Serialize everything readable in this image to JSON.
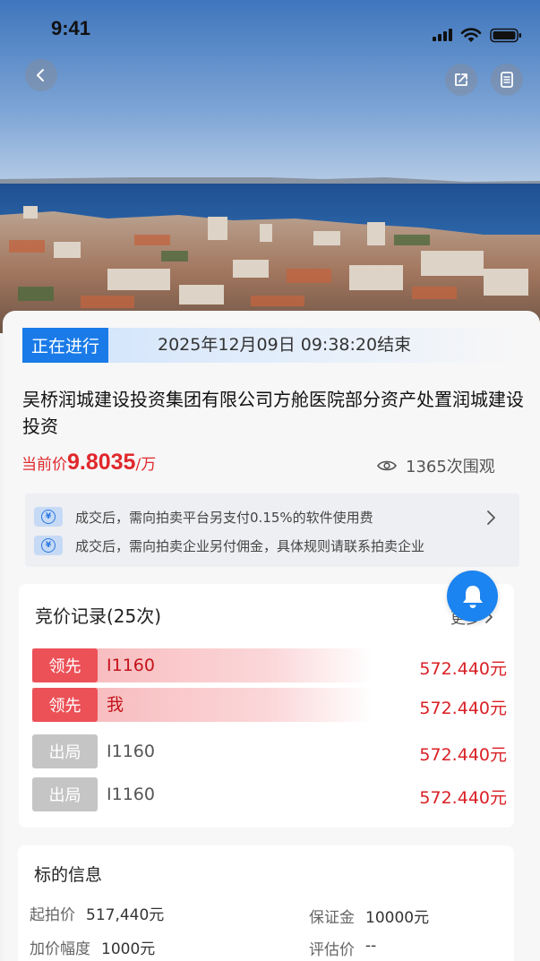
{
  "status_bar": {
    "time": "9:41"
  },
  "nav": {
    "back_icon": "chevron-left-icon",
    "share_icon": "share-icon",
    "doc_icon": "document-icon"
  },
  "auction": {
    "status_label": "正在进行",
    "end_time": "2025年12月09日 09:38:20结束",
    "title": "吴桥润城建设投资集团有限公司方舱医院部分资产处置润城建设投资",
    "price_label": "当前价",
    "price_value": "9.8035",
    "price_unit": "/万",
    "views": "1365次围观"
  },
  "notices": [
    {
      "text": "成交后，需向拍卖平台另支付0.15%的软件使用费"
    },
    {
      "text": "成交后，需向拍卖企业另付佣金，具体规则请联系拍卖企业"
    }
  ],
  "bid_record": {
    "title": "竞价记录(25次)",
    "more_label": "更多",
    "rows": [
      {
        "tag": "领先",
        "bidder": "I1160",
        "amount": "572.440元"
      },
      {
        "tag": "领先",
        "bidder": "我",
        "amount": "572.440元"
      },
      {
        "tag": "出局",
        "bidder": "I1160",
        "amount": "572.440元"
      },
      {
        "tag": "出局",
        "bidder": "I1160",
        "amount": "572.440元"
      }
    ]
  },
  "subject_info": {
    "title": "标的信息",
    "start_price_label": "起拍价",
    "start_price": "517,440元",
    "deposit_label": "保证金",
    "deposit": "10000元",
    "increment_label": "加价幅度",
    "increment": "1000元",
    "appraisal_label": "评估价",
    "appraisal": "--"
  },
  "colors": {
    "accent_blue": "#1a7be8",
    "price_red": "#e0282b",
    "lead_red": "#ec5158",
    "out_gray": "#c5c5c5"
  }
}
